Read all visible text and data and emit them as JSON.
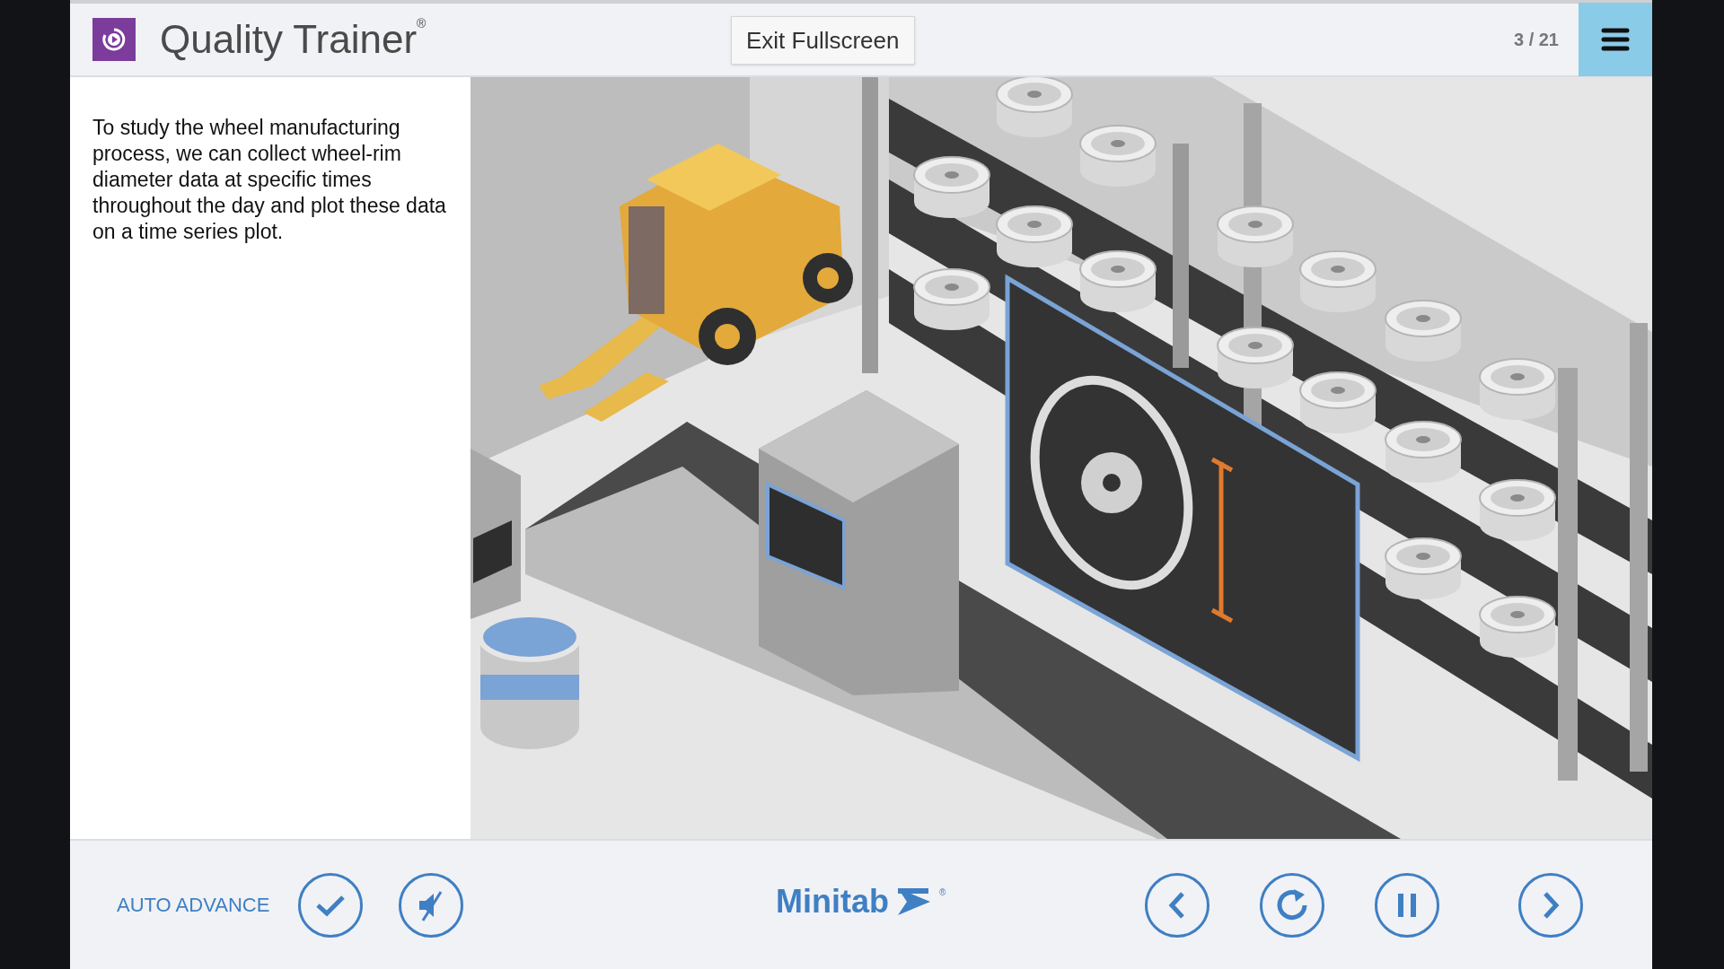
{
  "header": {
    "title": "Quality Trainer",
    "title_mark": "®",
    "exit_button": "Exit Fullscreen",
    "page_counter": "3 / 21"
  },
  "lesson": {
    "text": "To study the wheel manufacturing process, we can collect wheel-rim diameter data at specific times throughout the day and plot these data on a time series plot."
  },
  "footer": {
    "auto_advance": {
      "label": "AUTO ADVANCE",
      "checked": true
    },
    "sound": {
      "muted": true
    },
    "brand": "Minitab",
    "brand_mark": "®",
    "playback": {
      "playing": true
    }
  }
}
